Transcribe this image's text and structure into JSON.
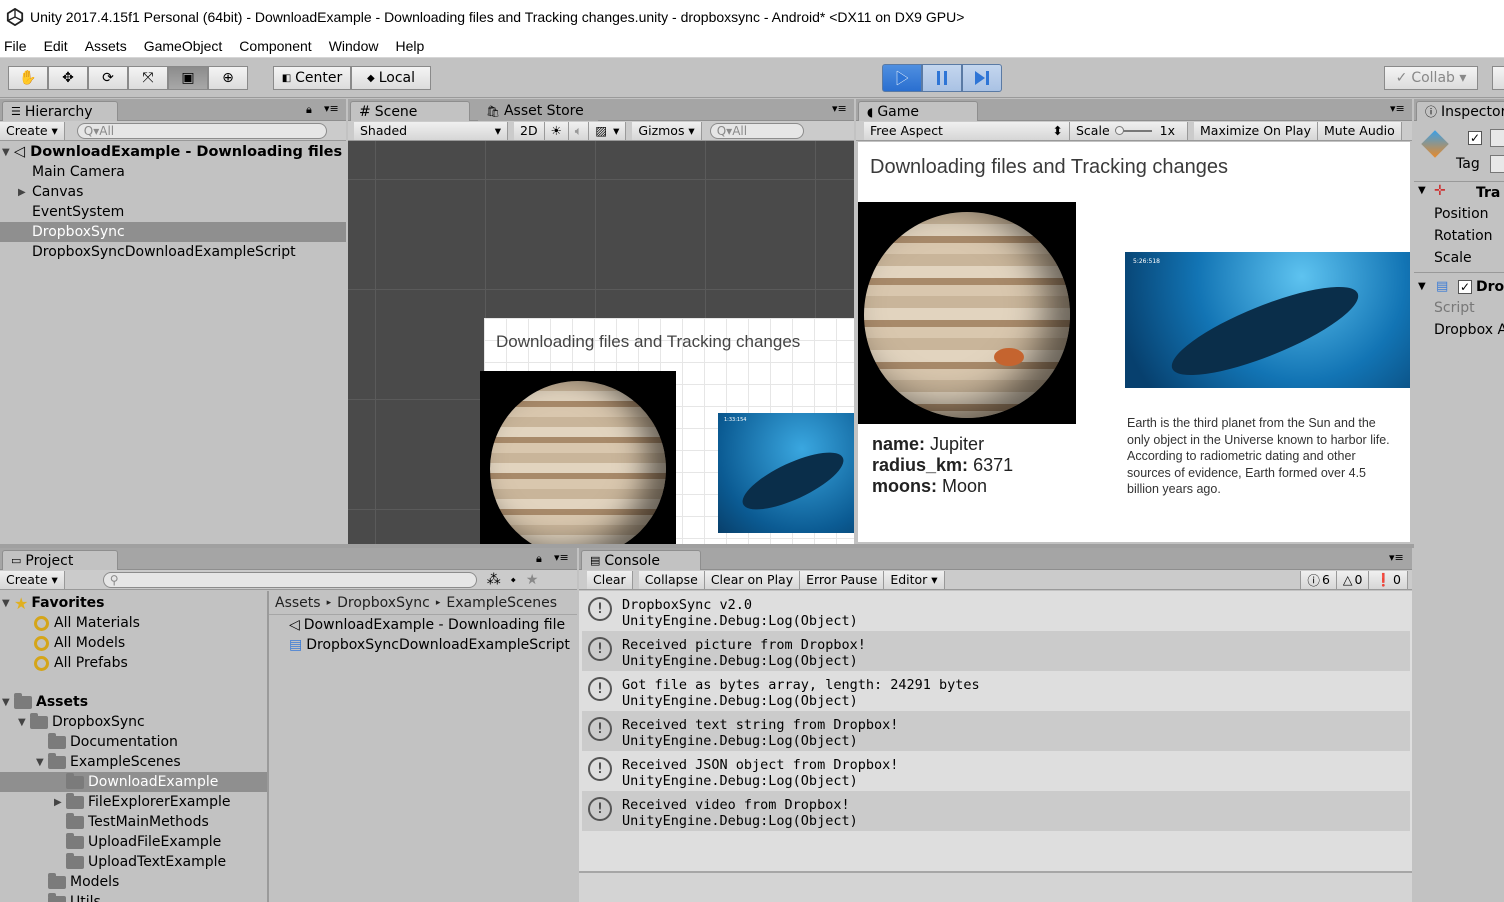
{
  "window": {
    "title": "Unity 2017.4.15f1 Personal (64bit) - DownloadExample - Downloading files and Tracking changes.unity - dropboxsync - Android* <DX11 on DX9 GPU>"
  },
  "menu": [
    "File",
    "Edit",
    "Assets",
    "GameObject",
    "Component",
    "Window",
    "Help"
  ],
  "toolbar": {
    "center_label": "Center",
    "local_label": "Local",
    "collab_label": "Collab ▾"
  },
  "hierarchy": {
    "tab": "Hierarchy",
    "create": "Create ▾",
    "search": "Q▾All",
    "scene": "DownloadExample - Downloading files",
    "items": [
      "Main Camera",
      "Canvas",
      "EventSystem",
      "DropboxSync",
      "DropboxSyncDownloadExampleScript"
    ]
  },
  "scene": {
    "tab": "Scene",
    "asset_store_tab": "Asset Store",
    "shading": "Shaded",
    "mode2d": "2D",
    "gizmos": "Gizmos ▾",
    "search": "Q▾All",
    "canvas_title": "Downloading files and Tracking changes",
    "whale_caption": "1:33:154"
  },
  "game": {
    "tab": "Game",
    "aspect": "Free Aspect",
    "scale_label": "Scale",
    "scale_value": "1x",
    "maximize": "Maximize On Play",
    "mute": "Mute Audio",
    "title": "Downloading files and Tracking changes",
    "info": [
      {
        "key": "name:",
        "value": "Jupiter"
      },
      {
        "key": "radius_km:",
        "value": "6371"
      },
      {
        "key": "moons:",
        "value": "Moon"
      }
    ],
    "earth_text": "Earth is the third planet from the Sun and the only object in the Universe known to harbor life. According to radiometric dating and other sources of evidence, Earth formed over 4.5 billion years ago.",
    "whale_caption": "5:26:518"
  },
  "inspector": {
    "tab": "Inspector",
    "tag": "Tag",
    "transform": "Tra",
    "rows": [
      "Position",
      "Rotation",
      "Scale"
    ],
    "component": "Dro",
    "script": "Script",
    "dropbox": "Dropbox A"
  },
  "project": {
    "tab": "Project",
    "create": "Create ▾",
    "favorites_label": "Favorites",
    "favorites": [
      "All Materials",
      "All Models",
      "All Prefabs"
    ],
    "assets_label": "Assets",
    "tree": [
      {
        "label": "DropboxSync",
        "indent": 1,
        "open": true
      },
      {
        "label": "Documentation",
        "indent": 2
      },
      {
        "label": "ExampleScenes",
        "indent": 2,
        "open": true
      },
      {
        "label": "DownloadExample",
        "indent": 3,
        "selected": true
      },
      {
        "label": "FileExplorerExample",
        "indent": 3,
        "closed": true
      },
      {
        "label": "TestMainMethods",
        "indent": 3
      },
      {
        "label": "UploadFileExample",
        "indent": 3
      },
      {
        "label": "UploadTextExample",
        "indent": 3
      },
      {
        "label": "Models",
        "indent": 2
      },
      {
        "label": "Utils",
        "indent": 2
      }
    ],
    "breadcrumb": [
      "Assets",
      "DropboxSync",
      "ExampleScenes"
    ],
    "files": [
      "DownloadExample - Downloading file",
      "DropboxSyncDownloadExampleScript"
    ]
  },
  "console": {
    "tab": "Console",
    "buttons": [
      "Clear",
      "Collapse",
      "Clear on Play",
      "Error Pause",
      "Editor ▾"
    ],
    "counts": {
      "info": "6",
      "warn": "0",
      "error": "0"
    },
    "entries": [
      {
        "line1": "DropboxSync v2.0",
        "line2": "UnityEngine.Debug:Log(Object)"
      },
      {
        "line1": "Received picture from Dropbox!",
        "line2": "UnityEngine.Debug:Log(Object)"
      },
      {
        "line1": "Got file as bytes array, length: 24291 bytes",
        "line2": "UnityEngine.Debug:Log(Object)"
      },
      {
        "line1": "Received text string from Dropbox!",
        "line2": "UnityEngine.Debug:Log(Object)"
      },
      {
        "line1": "Received JSON object from Dropbox!",
        "line2": "UnityEngine.Debug:Log(Object)"
      },
      {
        "line1": "Received video from Dropbox!",
        "line2": "UnityEngine.Debug:Log(Object)"
      }
    ]
  },
  "colors": {
    "accent": "#3c7cd6",
    "selection": "#8f8f8f",
    "panel": "#c2c2c2"
  }
}
